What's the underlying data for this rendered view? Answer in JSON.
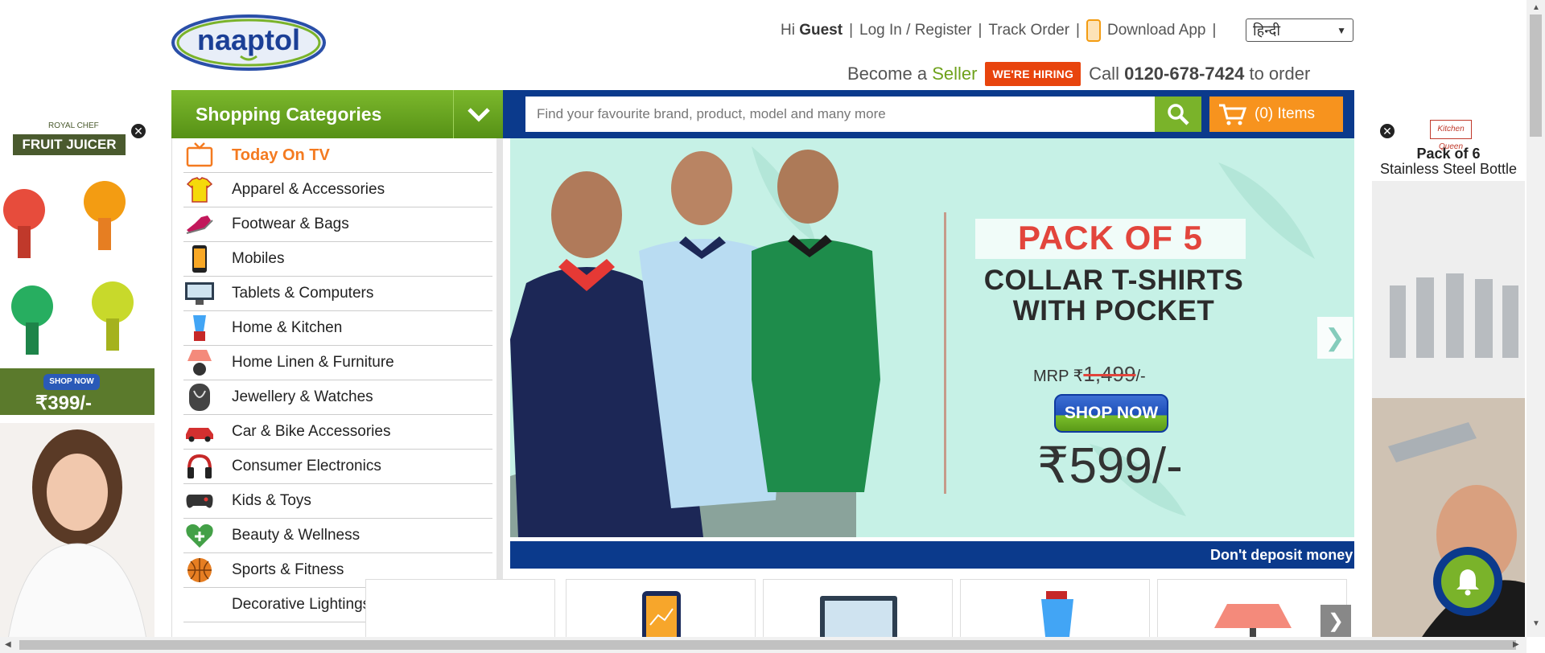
{
  "header": {
    "logo_text": "naaptol",
    "greeting_prefix": "Hi",
    "greeting_user": "Guest",
    "login_label": "Log In / Register",
    "track_label": "Track Order",
    "download_label": "Download App",
    "language_selected": "हिन्दी",
    "become_prefix": "Become a",
    "become_seller": "Seller",
    "hiring_label": "WE'RE HIRING",
    "call_prefix": "Call",
    "call_number": "0120-678-7424",
    "call_suffix": "to order"
  },
  "nav": {
    "categories_title": "Shopping Categories",
    "search_placeholder": "Find your favourite brand, product, model and many more",
    "cart_label": "(0) Items"
  },
  "categories": [
    {
      "label": "Today On TV",
      "icon": "tv-icon"
    },
    {
      "label": "Apparel & Accessories",
      "icon": "tshirt-icon"
    },
    {
      "label": "Footwear & Bags",
      "icon": "shoe-icon"
    },
    {
      "label": "Mobiles",
      "icon": "mobile-icon"
    },
    {
      "label": "Tablets & Computers",
      "icon": "monitor-icon"
    },
    {
      "label": "Home & Kitchen",
      "icon": "blender-icon"
    },
    {
      "label": "Home Linen & Furniture",
      "icon": "lamp-icon"
    },
    {
      "label": "Jewellery & Watches",
      "icon": "necklace-icon"
    },
    {
      "label": "Car & Bike Accessories",
      "icon": "car-icon"
    },
    {
      "label": "Consumer Electronics",
      "icon": "headphones-icon"
    },
    {
      "label": "Kids & Toys",
      "icon": "gamepad-icon"
    },
    {
      "label": "Beauty & Wellness",
      "icon": "heart-plus-icon"
    },
    {
      "label": "Sports & Fitness",
      "icon": "basketball-icon"
    },
    {
      "label": "Decorative Lightings",
      "icon": ""
    }
  ],
  "banner": {
    "title": "PACK OF 5",
    "subtitle_line1": "COLLAR T-SHIRTS",
    "subtitle_line2": "WITH POCKET",
    "mrp_label": "MRP ₹",
    "mrp_value": "1,499",
    "mrp_suffix": "/-",
    "shop_label": "SHOP NOW",
    "price": "₹599/-"
  },
  "ticker": {
    "text": "Don't deposit money"
  },
  "ad_left": {
    "brand": "ROYAL CHEF",
    "title": "FRUIT JUICER",
    "shop_label": "SHOP NOW",
    "price": "₹399/-"
  },
  "ad_right": {
    "brand": "Kitchen Queen",
    "title": "Pack of 6",
    "subtitle": "Stainless Steel Bottle"
  },
  "colors": {
    "brand_blue": "#0b3a8c",
    "brand_green": "#7ab32a",
    "accent_orange": "#f7931e",
    "hiring_red": "#e8440d"
  }
}
